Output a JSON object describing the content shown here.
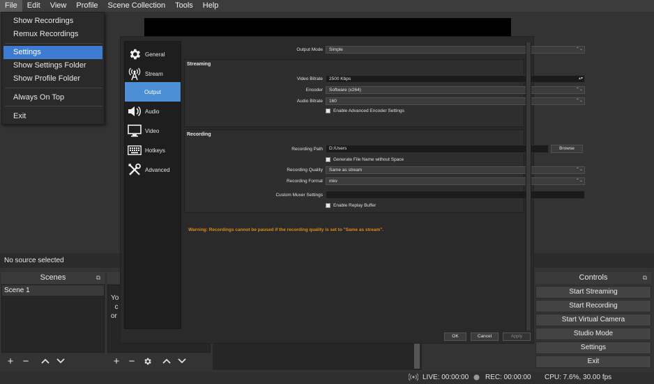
{
  "menubar": {
    "items": [
      "File",
      "Edit",
      "View",
      "Profile",
      "Scene Collection",
      "Tools",
      "Help"
    ]
  },
  "file_menu": {
    "items": [
      "Show Recordings",
      "Remux Recordings",
      "Settings",
      "Show Settings Folder",
      "Show Profile Folder",
      "Always On Top",
      "Exit"
    ],
    "selected": "Settings"
  },
  "status_line": {
    "no_source": "No source selected"
  },
  "scenes": {
    "title": "Scenes",
    "items": [
      "Scene 1"
    ]
  },
  "sources": {
    "hint_text": "Yo\n  c\nor "
  },
  "controls": {
    "title": "Controls",
    "buttons": [
      "Start Streaming",
      "Start Recording",
      "Start Virtual Camera",
      "Studio Mode",
      "Settings",
      "Exit"
    ]
  },
  "statusbar": {
    "live": "LIVE: 00:00:00",
    "rec": "REC: 00:00:00",
    "cpu": "CPU: 7.6%, 30.00 fps"
  },
  "settings": {
    "sidebar": [
      {
        "label": "General",
        "icon": "gear-icon"
      },
      {
        "label": "Stream",
        "icon": "antenna-icon"
      },
      {
        "label": "Output",
        "icon": "output-icon"
      },
      {
        "label": "Audio",
        "icon": "speaker-icon"
      },
      {
        "label": "Video",
        "icon": "monitor-icon"
      },
      {
        "label": "Hotkeys",
        "icon": "keyboard-icon"
      },
      {
        "label": "Advanced",
        "icon": "tools-icon"
      }
    ],
    "active": "Output",
    "output_mode": {
      "label": "Output Mode",
      "value": "Simple"
    },
    "streaming": {
      "title": "Streaming",
      "video_bitrate": {
        "label": "Video Bitrate",
        "value": "2500 Kbps"
      },
      "encoder": {
        "label": "Encoder",
        "value": "Software (x264)"
      },
      "audio_bitrate": {
        "label": "Audio Bitrate",
        "value": "160"
      },
      "advanced_encoder": "Enable Advanced Encoder Settings"
    },
    "recording": {
      "title": "Recording",
      "path": {
        "label": "Recording Path",
        "value": "D:/Users"
      },
      "browse": "Browse",
      "no_space": "Generate File Name without Space",
      "quality": {
        "label": "Recording Quality",
        "value": "Same as stream"
      },
      "format": {
        "label": "Recording Format",
        "value": "mkv"
      },
      "muxer": {
        "label": "Custom Muxer Settings",
        "value": ""
      },
      "replay_buffer": "Enable Replay Buffer"
    },
    "warning": "Warning: Recordings cannot be paused if the recording quality is set to \"Same as stream\".",
    "buttons": {
      "ok": "OK",
      "cancel": "Cancel",
      "apply": "Apply"
    }
  }
}
